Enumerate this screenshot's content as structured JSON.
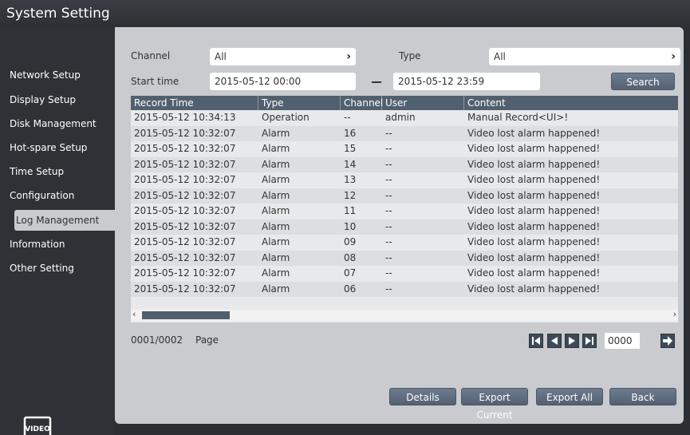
{
  "window": {
    "title": "System Setting"
  },
  "sidebar": {
    "items": [
      {
        "label": "Network Setup"
      },
      {
        "label": "Display Setup"
      },
      {
        "label": "Disk Management"
      },
      {
        "label": "Hot-spare Setup"
      },
      {
        "label": "Time Setup"
      },
      {
        "label": "Configuration"
      },
      {
        "label": "Log Management",
        "active": true
      },
      {
        "label": "Information"
      },
      {
        "label": "Other Setting"
      }
    ],
    "logo_text": "VIDEO"
  },
  "filters": {
    "channel_label": "Channel",
    "channel_value": "All",
    "type_label": "Type",
    "type_value": "All",
    "start_label": "Start time",
    "start_value": "2015-05-12 00:00",
    "end_value": "2015-05-12 23:59",
    "search_label": "Search"
  },
  "table": {
    "columns": [
      "Record Time",
      "Type",
      "Channel",
      "User",
      "Content"
    ],
    "rows": [
      [
        "2015-05-12 10:34:13",
        "Operation",
        "--",
        "admin",
        "Manual Record<UI>!"
      ],
      [
        "2015-05-12 10:32:07",
        "Alarm",
        "16",
        "--",
        "Video lost alarm happened!"
      ],
      [
        "2015-05-12 10:32:07",
        "Alarm",
        "15",
        "--",
        "Video lost alarm happened!"
      ],
      [
        "2015-05-12 10:32:07",
        "Alarm",
        "14",
        "--",
        "Video lost alarm happened!"
      ],
      [
        "2015-05-12 10:32:07",
        "Alarm",
        "13",
        "--",
        "Video lost alarm happened!"
      ],
      [
        "2015-05-12 10:32:07",
        "Alarm",
        "12",
        "--",
        "Video lost alarm happened!"
      ],
      [
        "2015-05-12 10:32:07",
        "Alarm",
        "11",
        "--",
        "Video lost alarm happened!"
      ],
      [
        "2015-05-12 10:32:07",
        "Alarm",
        "10",
        "--",
        "Video lost alarm happened!"
      ],
      [
        "2015-05-12 10:32:07",
        "Alarm",
        "09",
        "--",
        "Video lost alarm happened!"
      ],
      [
        "2015-05-12 10:32:07",
        "Alarm",
        "08",
        "--",
        "Video lost alarm happened!"
      ],
      [
        "2015-05-12 10:32:07",
        "Alarm",
        "07",
        "--",
        "Video lost alarm happened!"
      ],
      [
        "2015-05-12 10:32:07",
        "Alarm",
        "06",
        "--",
        "Video lost alarm happened!"
      ]
    ]
  },
  "pager": {
    "counter": "0001/0002",
    "page_label": "Page",
    "page_input": "0000"
  },
  "actions": {
    "details": "Details",
    "export_current": "Export Current",
    "export_all": "Export All",
    "back": "Back"
  },
  "colors": {
    "header_bar": "#51606f",
    "panel": "#c9cbcf",
    "sidebar": "#2e3136",
    "button": "#5f6e80"
  }
}
